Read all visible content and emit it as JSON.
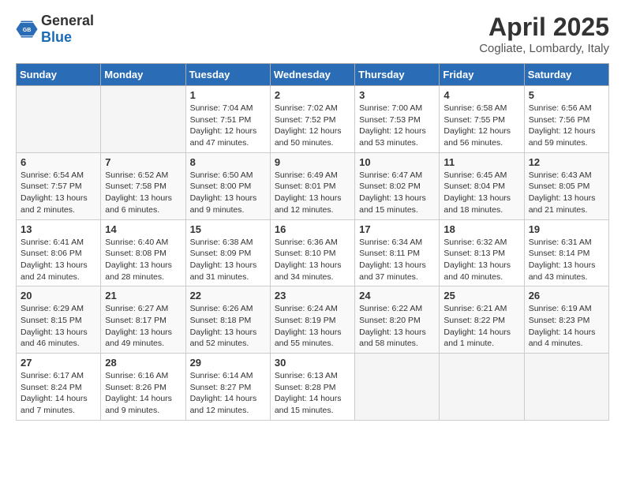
{
  "logo": {
    "general": "General",
    "blue": "Blue"
  },
  "header": {
    "title": "April 2025",
    "subtitle": "Cogliate, Lombardy, Italy"
  },
  "weekdays": [
    "Sunday",
    "Monday",
    "Tuesday",
    "Wednesday",
    "Thursday",
    "Friday",
    "Saturday"
  ],
  "weeks": [
    [
      {
        "day": "",
        "info": ""
      },
      {
        "day": "",
        "info": ""
      },
      {
        "day": "1",
        "info": "Sunrise: 7:04 AM\nSunset: 7:51 PM\nDaylight: 12 hours and 47 minutes."
      },
      {
        "day": "2",
        "info": "Sunrise: 7:02 AM\nSunset: 7:52 PM\nDaylight: 12 hours and 50 minutes."
      },
      {
        "day": "3",
        "info": "Sunrise: 7:00 AM\nSunset: 7:53 PM\nDaylight: 12 hours and 53 minutes."
      },
      {
        "day": "4",
        "info": "Sunrise: 6:58 AM\nSunset: 7:55 PM\nDaylight: 12 hours and 56 minutes."
      },
      {
        "day": "5",
        "info": "Sunrise: 6:56 AM\nSunset: 7:56 PM\nDaylight: 12 hours and 59 minutes."
      }
    ],
    [
      {
        "day": "6",
        "info": "Sunrise: 6:54 AM\nSunset: 7:57 PM\nDaylight: 13 hours and 2 minutes."
      },
      {
        "day": "7",
        "info": "Sunrise: 6:52 AM\nSunset: 7:58 PM\nDaylight: 13 hours and 6 minutes."
      },
      {
        "day": "8",
        "info": "Sunrise: 6:50 AM\nSunset: 8:00 PM\nDaylight: 13 hours and 9 minutes."
      },
      {
        "day": "9",
        "info": "Sunrise: 6:49 AM\nSunset: 8:01 PM\nDaylight: 13 hours and 12 minutes."
      },
      {
        "day": "10",
        "info": "Sunrise: 6:47 AM\nSunset: 8:02 PM\nDaylight: 13 hours and 15 minutes."
      },
      {
        "day": "11",
        "info": "Sunrise: 6:45 AM\nSunset: 8:04 PM\nDaylight: 13 hours and 18 minutes."
      },
      {
        "day": "12",
        "info": "Sunrise: 6:43 AM\nSunset: 8:05 PM\nDaylight: 13 hours and 21 minutes."
      }
    ],
    [
      {
        "day": "13",
        "info": "Sunrise: 6:41 AM\nSunset: 8:06 PM\nDaylight: 13 hours and 24 minutes."
      },
      {
        "day": "14",
        "info": "Sunrise: 6:40 AM\nSunset: 8:08 PM\nDaylight: 13 hours and 28 minutes."
      },
      {
        "day": "15",
        "info": "Sunrise: 6:38 AM\nSunset: 8:09 PM\nDaylight: 13 hours and 31 minutes."
      },
      {
        "day": "16",
        "info": "Sunrise: 6:36 AM\nSunset: 8:10 PM\nDaylight: 13 hours and 34 minutes."
      },
      {
        "day": "17",
        "info": "Sunrise: 6:34 AM\nSunset: 8:11 PM\nDaylight: 13 hours and 37 minutes."
      },
      {
        "day": "18",
        "info": "Sunrise: 6:32 AM\nSunset: 8:13 PM\nDaylight: 13 hours and 40 minutes."
      },
      {
        "day": "19",
        "info": "Sunrise: 6:31 AM\nSunset: 8:14 PM\nDaylight: 13 hours and 43 minutes."
      }
    ],
    [
      {
        "day": "20",
        "info": "Sunrise: 6:29 AM\nSunset: 8:15 PM\nDaylight: 13 hours and 46 minutes."
      },
      {
        "day": "21",
        "info": "Sunrise: 6:27 AM\nSunset: 8:17 PM\nDaylight: 13 hours and 49 minutes."
      },
      {
        "day": "22",
        "info": "Sunrise: 6:26 AM\nSunset: 8:18 PM\nDaylight: 13 hours and 52 minutes."
      },
      {
        "day": "23",
        "info": "Sunrise: 6:24 AM\nSunset: 8:19 PM\nDaylight: 13 hours and 55 minutes."
      },
      {
        "day": "24",
        "info": "Sunrise: 6:22 AM\nSunset: 8:20 PM\nDaylight: 13 hours and 58 minutes."
      },
      {
        "day": "25",
        "info": "Sunrise: 6:21 AM\nSunset: 8:22 PM\nDaylight: 14 hours and 1 minute."
      },
      {
        "day": "26",
        "info": "Sunrise: 6:19 AM\nSunset: 8:23 PM\nDaylight: 14 hours and 4 minutes."
      }
    ],
    [
      {
        "day": "27",
        "info": "Sunrise: 6:17 AM\nSunset: 8:24 PM\nDaylight: 14 hours and 7 minutes."
      },
      {
        "day": "28",
        "info": "Sunrise: 6:16 AM\nSunset: 8:26 PM\nDaylight: 14 hours and 9 minutes."
      },
      {
        "day": "29",
        "info": "Sunrise: 6:14 AM\nSunset: 8:27 PM\nDaylight: 14 hours and 12 minutes."
      },
      {
        "day": "30",
        "info": "Sunrise: 6:13 AM\nSunset: 8:28 PM\nDaylight: 14 hours and 15 minutes."
      },
      {
        "day": "",
        "info": ""
      },
      {
        "day": "",
        "info": ""
      },
      {
        "day": "",
        "info": ""
      }
    ]
  ]
}
